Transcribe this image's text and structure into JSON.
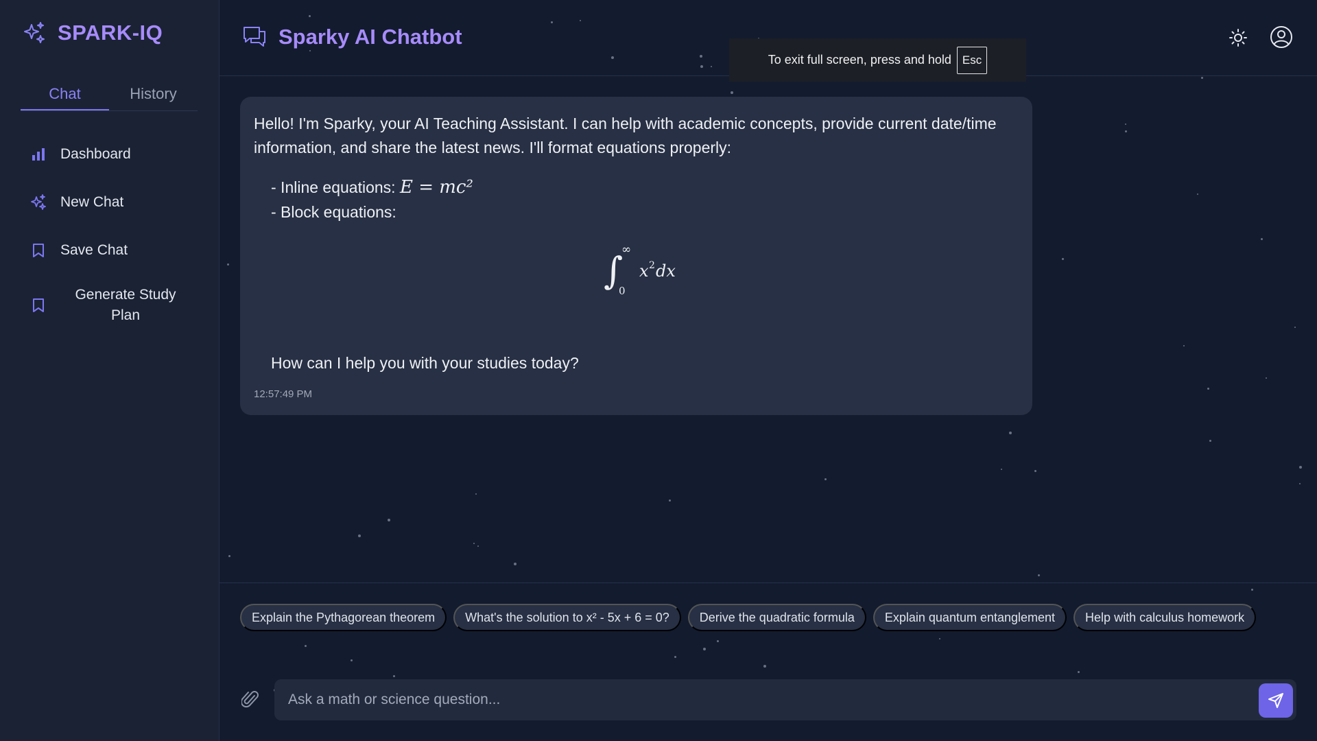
{
  "brand": {
    "name": "SPARK-IQ"
  },
  "sidebar": {
    "tabs": [
      {
        "label": "Chat"
      },
      {
        "label": "History"
      }
    ],
    "items": [
      {
        "label": "Dashboard",
        "icon": "bar-chart-icon"
      },
      {
        "label": "New Chat",
        "icon": "sparkle-icon"
      },
      {
        "label": "Save Chat",
        "icon": "bookmark-icon"
      },
      {
        "label": "Generate Study Plan",
        "icon": "bookmark-icon"
      }
    ]
  },
  "header": {
    "title": "Sparky AI Chatbot",
    "theme_icon": "sun-icon",
    "user_icon": "user-circle-icon"
  },
  "fullscreen_toast": {
    "text": "To exit full screen, press and hold",
    "key": "Esc"
  },
  "message": {
    "intro": "Hello! I'm Sparky, your AI Teaching Assistant. I can help with academic concepts, provide current date/time information, and share the latest news. I'll format equations properly:",
    "inline_label": "- Inline equations:",
    "inline_eq": "E = mc²",
    "block_label": "- Block equations:",
    "block_eq": "∫₀^∞ x² dx",
    "closing": "How can I help you with your studies today?",
    "timestamp": "12:57:49 PM"
  },
  "suggestions": [
    "Explain the Pythagorean theorem",
    "What's the solution to x² - 5x + 6 = 0?",
    "Derive the quadratic formula",
    "Explain quantum entanglement",
    "Help with calculus homework"
  ],
  "composer": {
    "placeholder": "Ask a math or science question..."
  },
  "colors": {
    "accent": "#a78bfa",
    "button": "#6d64e8",
    "background": "#131b2e",
    "sidebar": "#1a2234",
    "bubble": "#273044"
  }
}
